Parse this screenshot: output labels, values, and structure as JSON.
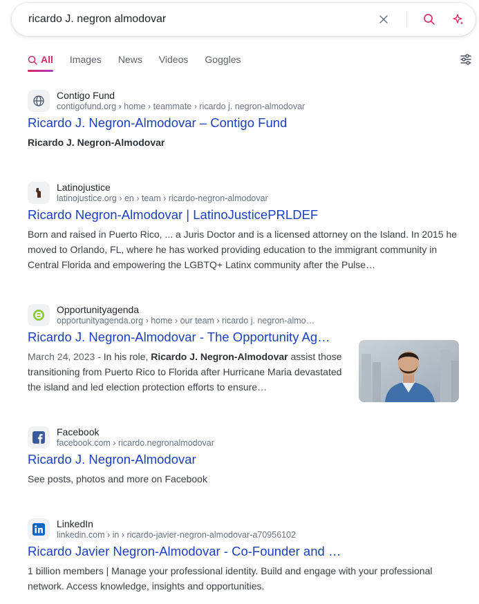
{
  "search": {
    "query": "ricardo J. negron almodovar"
  },
  "tabs": [
    {
      "label": "All",
      "active": true
    },
    {
      "label": "Images",
      "active": false
    },
    {
      "label": "News",
      "active": false
    },
    {
      "label": "Videos",
      "active": false
    },
    {
      "label": "Goggles",
      "active": false
    }
  ],
  "colors": {
    "accent": "#c62d6e",
    "link": "#1a3fbf",
    "url": "#6b7280"
  },
  "results": [
    {
      "site_name": "Contigo Fund",
      "url": "contigofund.org",
      "breadcrumb": "› home › teammate › ricardo j. negron-almodovar",
      "title": "Ricardo J. Negron-Almodovar – Contigo Fund",
      "snippet": "Ricardo J. Negron-Almodovar",
      "icon": "globe-icon"
    },
    {
      "site_name": "Latinojustice",
      "url": "latinojustice.org",
      "breadcrumb": "› en › team › ricardo-negron-almodovar",
      "title": "Ricardo Negron-Almodovar | LatinoJusticePRLDEF",
      "snippet": "Born and raised in Puerto Rico, ... a Juris Doctor and is a licensed attorney on the Island. In 2015 he moved to Orlando, FL, where he has worked providing education to the immigrant community in Central Florida and empowering the LGBTQ+ Latinx community after the Pulse…",
      "icon": "fist-icon"
    },
    {
      "site_name": "Opportunityagenda",
      "url": "opportunityagenda.org",
      "breadcrumb": "› home › our team › ricardo j. negron-almo…",
      "title": "Ricardo J. Negron-Almodovar - The Opportunity Ag…",
      "snippet_date": "March 24, 2023",
      "snippet_sep": " - ",
      "snippet_pre": "In his role, ",
      "snippet_bold": "Ricardo J. Negron-Almodovar",
      "snippet_post": " assist those transitioning from Puerto Rico to Florida after Hurricane Maria devastated the island and led election protection efforts to ensure…",
      "icon": "opportunity-agenda-icon"
    },
    {
      "site_name": "Facebook",
      "url": "facebook.com",
      "breadcrumb": "› ricardo.negronalmodovar",
      "title": "Ricardo J. Negron-Almodovar",
      "snippet": "See posts, photos and more on Facebook",
      "icon": "facebook-icon"
    },
    {
      "site_name": "LinkedIn",
      "url": "linkedin.com",
      "breadcrumb": "› in › ricardo-javier-negron-almodovar-a70956102",
      "title": "Ricardo Javier Negron-Almodovar - Co-Founder and …",
      "snippet": "1 billion members | Manage your professional identity. Build and engage with your professional network. Access knowledge, insights and opportunities.",
      "icon": "linkedin-icon"
    }
  ]
}
